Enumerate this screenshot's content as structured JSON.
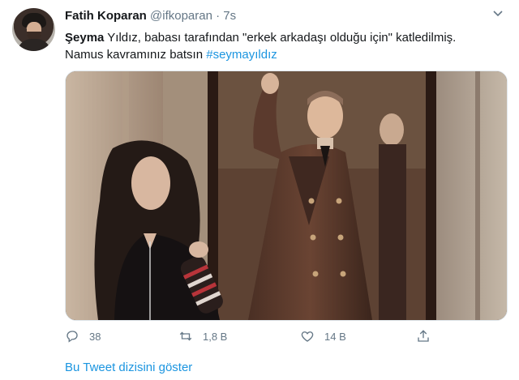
{
  "tweet": {
    "author_name": "Fatih Koparan",
    "handle": "@ifkoparan",
    "separator": "·",
    "time": "7s",
    "text_bold": "Şeyma",
    "text_line1": " Yıldız, babası tarafından \"erkek arkadaşı olduğu için\" katledilmiş.",
    "text_line2": "Namus kavramınız batsın ",
    "hashtag": "#seymayıldız"
  },
  "actions": {
    "replies": "38",
    "retweets": "1,8 B",
    "likes": "14 B"
  },
  "show_thread": "Bu Tweet dizisini göster",
  "colors": {
    "link": "#1b95e0",
    "muted": "#657786",
    "text": "#14171a"
  },
  "icons": [
    "user-avatar",
    "chevron-down-icon",
    "reply-icon",
    "retweet-icon",
    "like-icon",
    "share-icon"
  ]
}
